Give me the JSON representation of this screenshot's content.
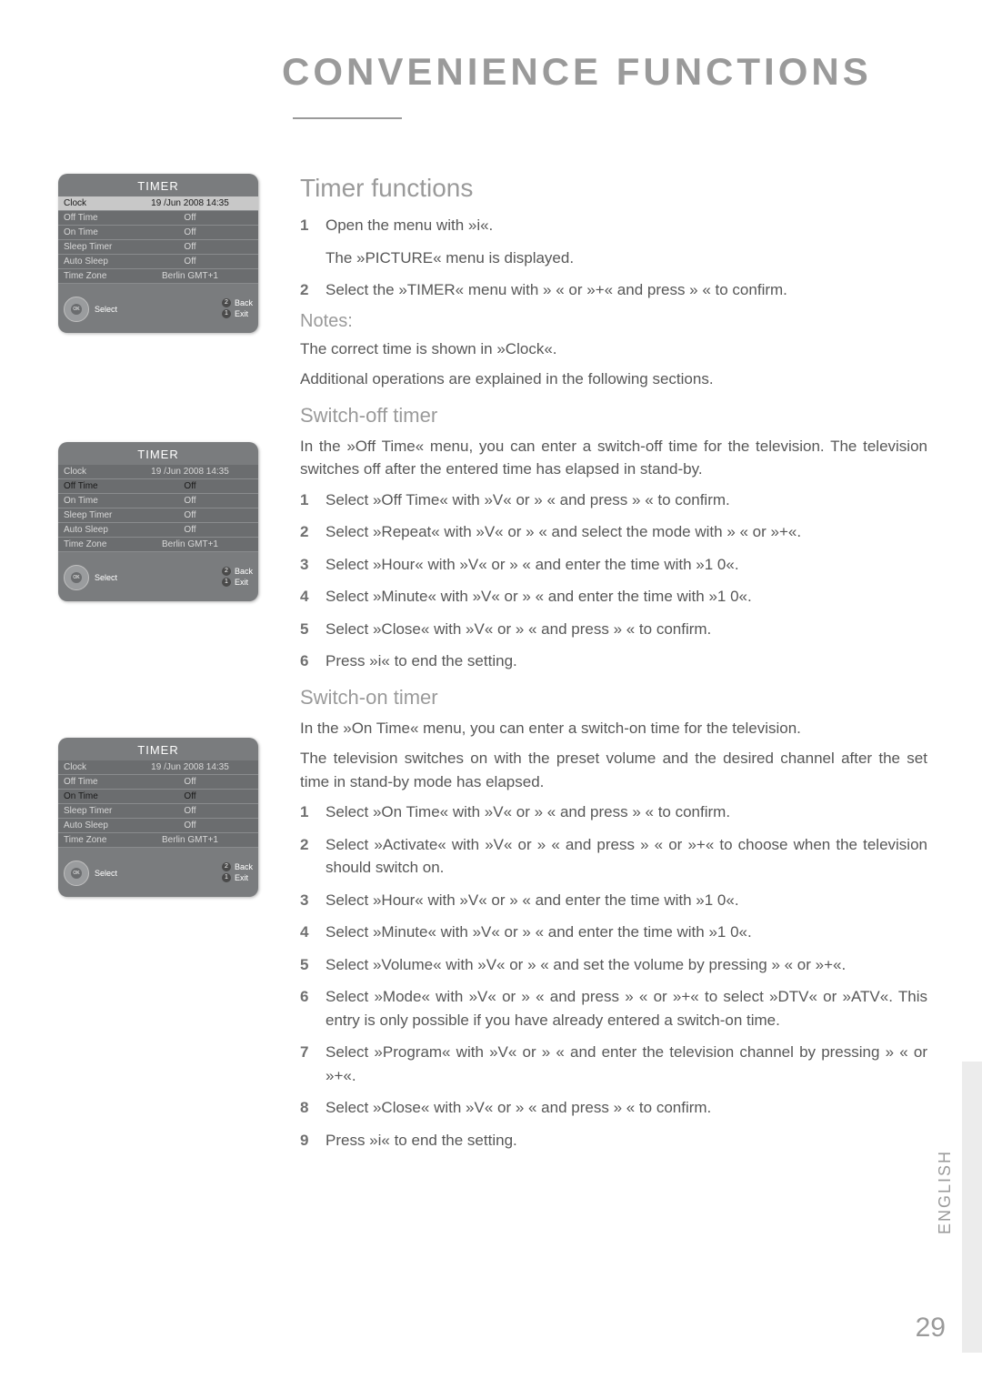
{
  "page": {
    "main_title": "CONVENIENCE FUNCTIONS",
    "section_title": "Timer functions",
    "notes_label": "Notes:",
    "switch_off_title": "Switch-off timer",
    "switch_on_title": "Switch-on timer",
    "page_number": "29",
    "lang": "ENGLISH"
  },
  "intro_steps": [
    {
      "n": "1",
      "t": "Open the menu with »i«.",
      "sub": "The »PICTURE« menu is displayed."
    },
    {
      "n": "2",
      "t": "Select the »TIMER« menu with »  « or »+« and press »  « to confirm."
    }
  ],
  "notes_body": [
    "The correct time is shown in »Clock«.",
    "Additional operations are explained in the following sections."
  ],
  "switch_off_intro": "In the »Off Time« menu, you can enter a switch-off time for the television. The television switches off after the entered time has elapsed in stand-by.",
  "switch_off_steps": [
    {
      "n": "1",
      "t": "Select »Off Time« with »V« or »  « and press »  « to confirm."
    },
    {
      "n": "2",
      "t": "Select »Repeat« with »V« or »  « and select the mode with »  « or »+«."
    },
    {
      "n": "3",
      "t": "Select »Hour« with »V« or »  « and enter the time with »1   0«."
    },
    {
      "n": "4",
      "t": "Select »Minute« with »V« or »  « and enter the time with »1   0«."
    },
    {
      "n": "5",
      "t": "Select »Close« with »V« or »  « and press »  « to confirm."
    },
    {
      "n": "6",
      "t": "Press »i« to end the setting."
    }
  ],
  "switch_on_intro1": "In the »On Time« menu, you can enter a switch-on time for the television.",
  "switch_on_intro2": "The television switches on with the preset volume and the desired channel after the set time in stand-by mode has elapsed.",
  "switch_on_steps": [
    {
      "n": "1",
      "t": "Select »On Time« with »V« or »  « and press »  « to confirm."
    },
    {
      "n": "2",
      "t": "Select »Activate« with »V« or »  « and press »  « or »+« to choose when the television should switch on."
    },
    {
      "n": "3",
      "t": "Select »Hour« with »V« or »  « and enter the time with »1   0«."
    },
    {
      "n": "4",
      "t": "Select »Minute« with »V« or »  « and enter the time with »1   0«."
    },
    {
      "n": "5",
      "t": "Select »Volume« with »V« or »  « and set the volume by pressing »  « or »+«."
    },
    {
      "n": "6",
      "t": "Select »Mode« with »V« or »  « and press »  « or »+« to select »DTV« or »ATV«. This entry is only possible if you have already entered a switch-on time."
    },
    {
      "n": "7",
      "t": "Select »Program« with »V« or »  « and enter the television channel by pressing »  « or »+«."
    },
    {
      "n": "8",
      "t": "Select »Close« with »V« or »  « and press »  « to confirm."
    },
    {
      "n": "9",
      "t": "Press »i« to end the setting."
    }
  ],
  "timer": {
    "title": "TIMER",
    "rows": [
      {
        "lbl": "Clock",
        "val": "19 /Jun 2008 14:35"
      },
      {
        "lbl": "Off Time",
        "val": "Off"
      },
      {
        "lbl": "On Time",
        "val": "Off"
      },
      {
        "lbl": "Sleep Timer",
        "val": "Off"
      },
      {
        "lbl": "Auto Sleep",
        "val": "Off"
      },
      {
        "lbl": "Time Zone",
        "val": "Berlin GMT+1"
      }
    ],
    "select": "Select",
    "back": "Back",
    "exit": "Exit"
  },
  "panel_variants": [
    {
      "highlight": 0,
      "black_rows": []
    },
    {
      "highlight": -1,
      "black_rows": [
        1
      ]
    },
    {
      "highlight": -1,
      "black_rows": [
        2
      ]
    }
  ]
}
